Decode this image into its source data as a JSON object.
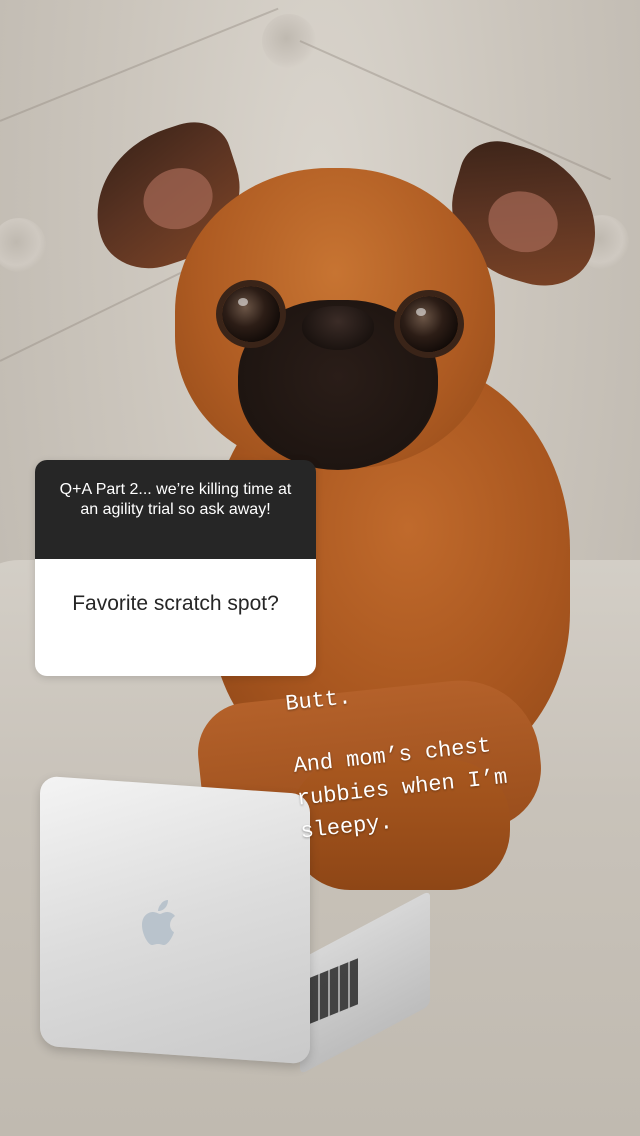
{
  "story": {
    "question_sticker": {
      "prompt": "Q+A Part 2... we’re killing time at an agility trial so ask away!",
      "answer": "Favorite scratch spot?"
    },
    "overlay_text": {
      "line1": "Butt.",
      "reply": "And mom’s chest\nrubbies when I’m\nsleepy."
    }
  },
  "colors": {
    "sticker_header_bg": "#262626",
    "sticker_body_bg": "#ffffff",
    "overlay_text": "#ffffff"
  },
  "icons": {
    "laptop_logo": "apple-logo-icon"
  }
}
